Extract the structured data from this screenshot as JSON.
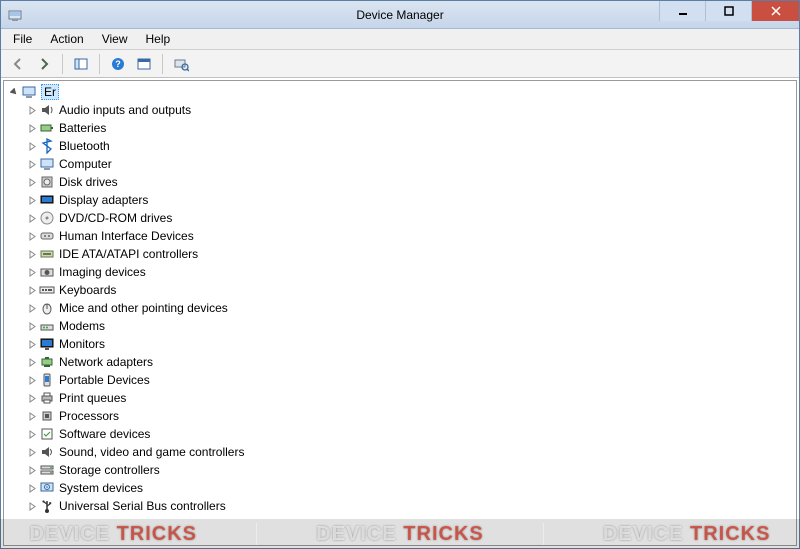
{
  "window": {
    "title": "Device Manager"
  },
  "menu": {
    "items": [
      "File",
      "Action",
      "View",
      "Help"
    ]
  },
  "toolbar": {
    "back": "back-arrow-icon",
    "forward": "forward-arrow-icon",
    "show_hide": "show-hide-console-tree-icon",
    "help": "help-icon",
    "properties": "properties-icon",
    "scan": "scan-for-hardware-changes-icon"
  },
  "tree": {
    "root": {
      "label": "Er",
      "expanded": true
    },
    "children": [
      {
        "icon": "audio-icon",
        "label": "Audio inputs and outputs"
      },
      {
        "icon": "battery-icon",
        "label": "Batteries"
      },
      {
        "icon": "bluetooth-icon",
        "label": "Bluetooth"
      },
      {
        "icon": "computer-icon",
        "label": "Computer"
      },
      {
        "icon": "disk-icon",
        "label": "Disk drives"
      },
      {
        "icon": "display-adapter-icon",
        "label": "Display adapters"
      },
      {
        "icon": "dvd-icon",
        "label": "DVD/CD-ROM drives"
      },
      {
        "icon": "hid-icon",
        "label": "Human Interface Devices"
      },
      {
        "icon": "ide-icon",
        "label": "IDE ATA/ATAPI controllers"
      },
      {
        "icon": "imaging-icon",
        "label": "Imaging devices"
      },
      {
        "icon": "keyboard-icon",
        "label": "Keyboards"
      },
      {
        "icon": "mouse-icon",
        "label": "Mice and other pointing devices"
      },
      {
        "icon": "modem-icon",
        "label": "Modems"
      },
      {
        "icon": "monitor-icon",
        "label": "Monitors"
      },
      {
        "icon": "network-icon",
        "label": "Network adapters"
      },
      {
        "icon": "portable-icon",
        "label": "Portable Devices"
      },
      {
        "icon": "printer-icon",
        "label": "Print queues"
      },
      {
        "icon": "processor-icon",
        "label": "Processors"
      },
      {
        "icon": "software-icon",
        "label": "Software devices"
      },
      {
        "icon": "sound-icon",
        "label": "Sound, video and game controllers"
      },
      {
        "icon": "storage-icon",
        "label": "Storage controllers"
      },
      {
        "icon": "system-icon",
        "label": "System devices"
      },
      {
        "icon": "usb-icon",
        "label": "Universal Serial Bus controllers"
      }
    ]
  },
  "watermark": {
    "device": "DEVICE",
    "tricks": "TRICKS"
  }
}
